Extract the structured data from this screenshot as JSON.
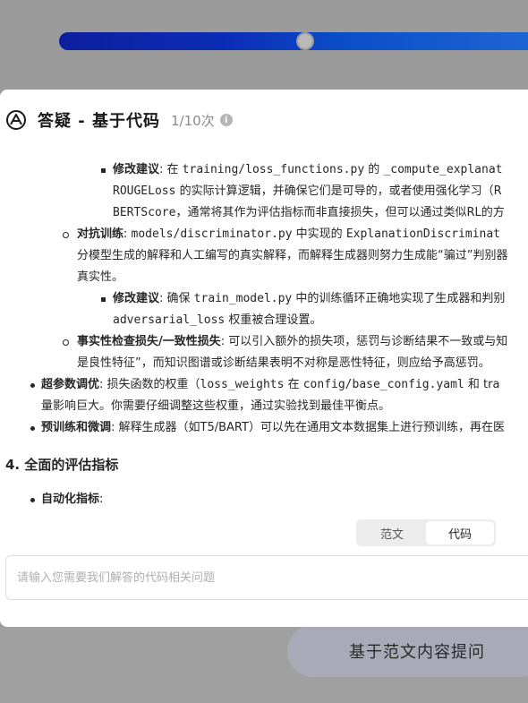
{
  "background": {
    "ask_button_label": "基于范文内容提问"
  },
  "modal": {
    "title": "答疑 - 基于代码",
    "quota": "1/10次"
  },
  "content": {
    "l1": {
      "label": "修改建议",
      "t1": ": 在 ",
      "code1": "training/loss_functions.py",
      "t2": " 的 ",
      "code2": "_compute_explanat"
    },
    "l2": {
      "code1": "ROUGELoss",
      "t1": " 的实际计算逻辑，并确保它们是可导的，或者使用强化学习（R"
    },
    "l3": {
      "code1": "BERTScore",
      "t1": "，通常将其作为评估指标而非直接损失，但可以通过类似RL的方"
    },
    "l4": {
      "label": "对抗训练",
      "t1": ": ",
      "code1": "models/discriminator.py",
      "t2": " 中实现的 ",
      "code2": "ExplanationDiscriminat"
    },
    "l5": {
      "t1": "分模型生成的解释和人工编写的真实解释，而解释生成器则努力生成能“骗过”判别器"
    },
    "l6": {
      "t1": "真实性。"
    },
    "l7": {
      "label": "修改建议",
      "t1": ": 确保 ",
      "code1": "train_model.py",
      "t2": " 中的训练循环正确地实现了生成器和判别"
    },
    "l8": {
      "code1": "adversarial_loss",
      "t1": " 权重被合理设置。"
    },
    "l9": {
      "label": "事实性检查损失/一致性损失",
      "t1": ": 可以引入额外的损失项，惩罚与诊断结果不一致或与知"
    },
    "l10": {
      "t1": "是良性特征”，而知识图谱或诊断结果表明不对称是恶性特征，则应给予高惩罚。"
    },
    "l11": {
      "label": "超参数调优",
      "t1": ": 损失函数的权重（",
      "code1": "loss_weights",
      "t2": " 在 ",
      "code2": "config/base_config.yaml",
      "t3": " 和 tra"
    },
    "l12": {
      "t1": "量影响巨大。你需要仔细调整这些权重，通过实验找到最佳平衡点。"
    },
    "l13": {
      "label": "预训练和微调",
      "t1": ": 解释生成器（如T5/BART）可以先在通用文本数据集上进行预训练，再在医"
    },
    "heading": "4. 全面的评估指标",
    "l14": {
      "label": "自动化指标",
      "t1": ":"
    }
  },
  "segment": {
    "options": [
      "范文",
      "代码"
    ],
    "selected": "代码"
  },
  "input": {
    "placeholder": "请输入您需要我们解答的代码相关问题",
    "value": ""
  }
}
